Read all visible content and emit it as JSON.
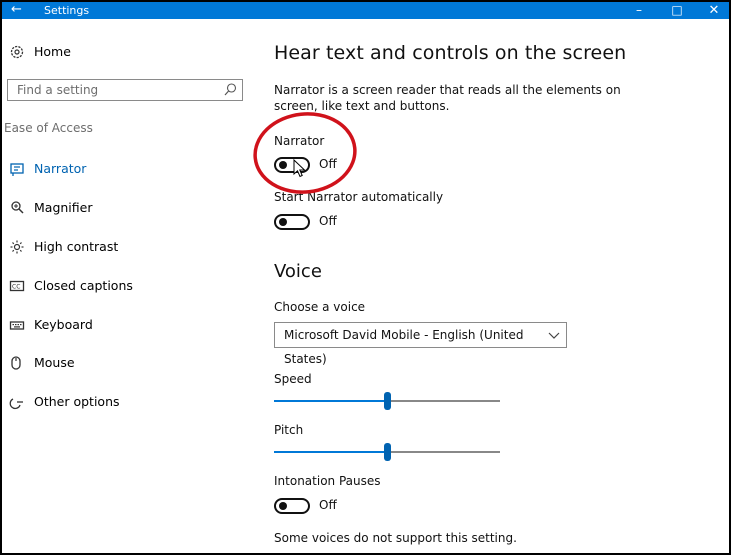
{
  "window": {
    "title": "Settings"
  },
  "sidebar": {
    "home_label": "Home",
    "search_placeholder": "Find a setting",
    "section_label": "Ease of Access",
    "items": [
      {
        "label": "Narrator",
        "icon": "narrator-icon",
        "selected": true
      },
      {
        "label": "Magnifier",
        "icon": "magnifier-icon"
      },
      {
        "label": "High contrast",
        "icon": "high-contrast-icon"
      },
      {
        "label": "Closed captions",
        "icon": "closed-captions-icon"
      },
      {
        "label": "Keyboard",
        "icon": "keyboard-icon"
      },
      {
        "label": "Mouse",
        "icon": "mouse-icon"
      },
      {
        "label": "Other options",
        "icon": "other-options-icon"
      }
    ]
  },
  "main": {
    "title": "Hear text and controls on the screen",
    "description": "Narrator is a screen reader that reads all the elements on screen, like text and buttons.",
    "narrator": {
      "label": "Narrator",
      "state": "Off"
    },
    "start_auto": {
      "label": "Start Narrator automatically",
      "state": "Off"
    },
    "voice_heading": "Voice",
    "choose_voice": {
      "label": "Choose a voice",
      "value": "Microsoft David Mobile - English (United States)"
    },
    "speed": {
      "label": "Speed",
      "value_percent": 50
    },
    "pitch": {
      "label": "Pitch",
      "value_percent": 50
    },
    "intonation": {
      "label": "Intonation Pauses",
      "state": "Off"
    },
    "note": "Some voices do not support this setting."
  },
  "colors": {
    "accent": "#0078d7",
    "selected_text": "#0063b1",
    "annotation": "#d0121b"
  }
}
